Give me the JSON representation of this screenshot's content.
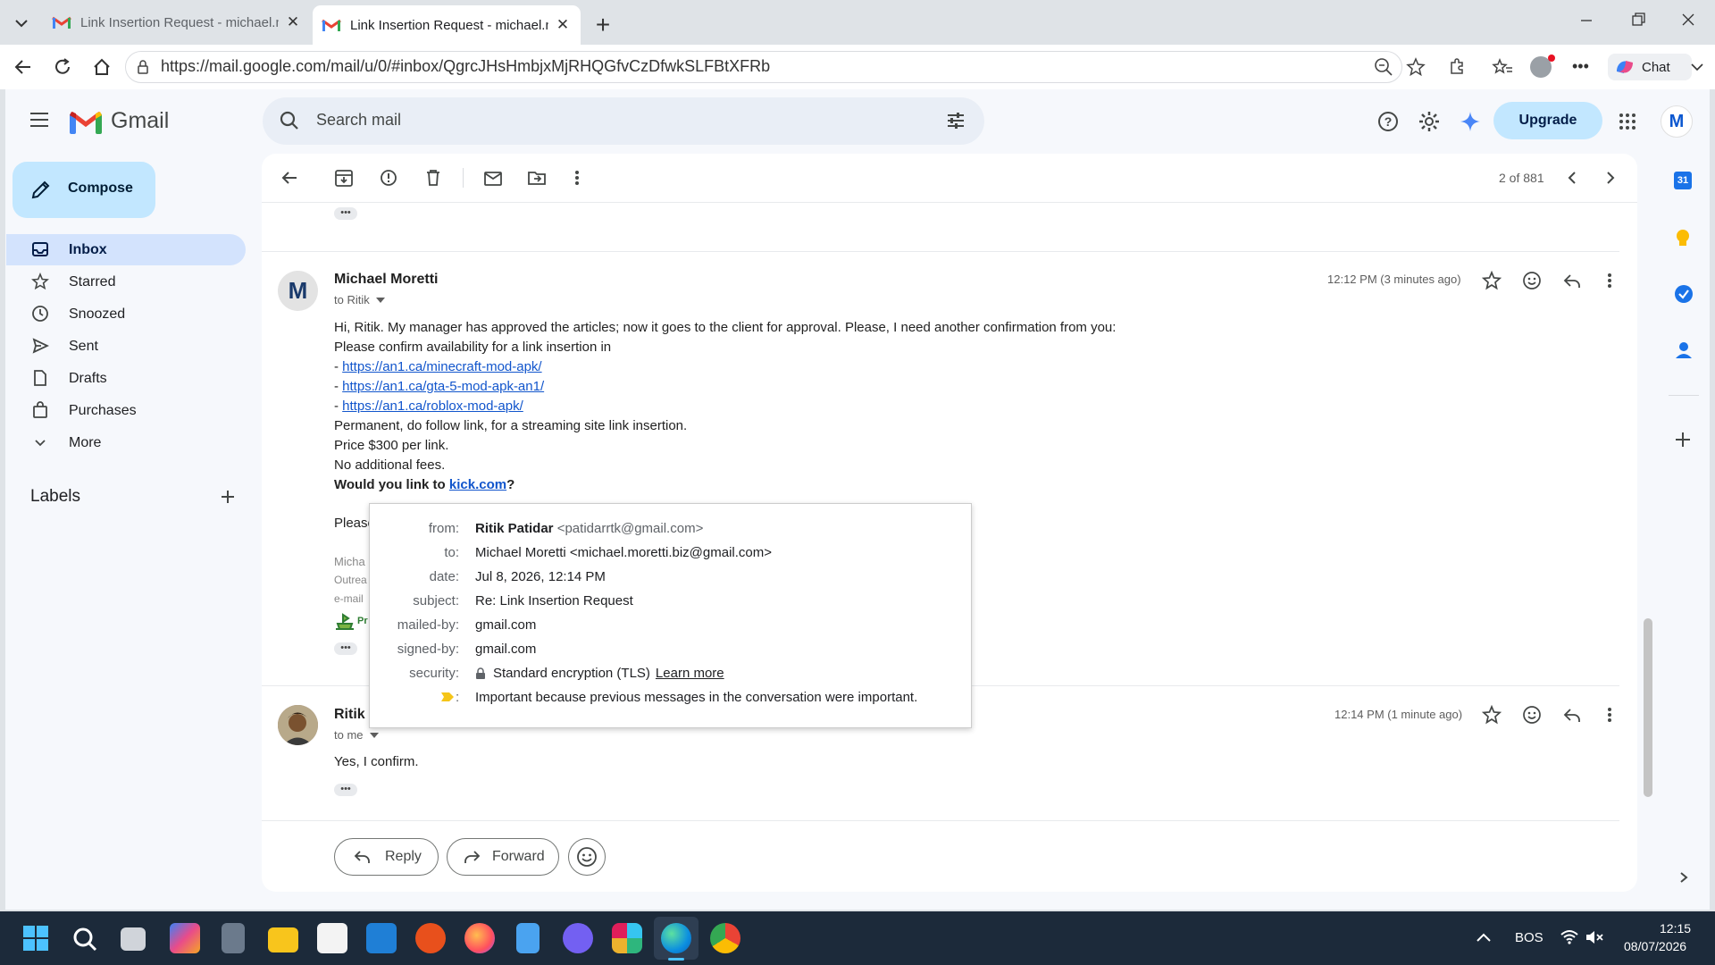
{
  "browser": {
    "tabs": [
      {
        "title": "Link Insertion Request - michael.m"
      },
      {
        "title": "Link Insertion Request - michael.m"
      }
    ],
    "url": "https://mail.google.com/mail/u/0/#inbox/QgrcJHsHmbjxMjRHQGfvCzDfwkSLFBtXFRb",
    "chat_label": "Chat"
  },
  "gmail": {
    "app_name": "Gmail",
    "search_placeholder": "Search mail",
    "upgrade_label": "Upgrade",
    "account_initial": "M",
    "compose_label": "Compose",
    "nav": [
      {
        "label": "Inbox"
      },
      {
        "label": "Starred"
      },
      {
        "label": "Snoozed"
      },
      {
        "label": "Sent"
      },
      {
        "label": "Drafts"
      },
      {
        "label": "Purchases"
      },
      {
        "label": "More"
      }
    ],
    "labels_heading": "Labels",
    "pager": "2 of 881",
    "calendar_day": "31"
  },
  "thread": {
    "msg1": {
      "sender": "Michael Moretti",
      "avatar": "M",
      "to": "to Ritik",
      "time": "12:12 PM (3 minutes ago)",
      "lines": [
        "Hi, Ritik. My manager has approved the articles; now it goes to the client for approval. Please, I need another confirmation from you:",
        "Please confirm availability for a link insertion in"
      ],
      "links": [
        "https://an1.ca/minecraft-mod-apk/",
        "https://an1.ca/gta-5-mod-apk-an1/",
        "https://an1.ca/roblox-mod-apk/"
      ],
      "link_prefix": "- ",
      "lines2": [
        "Permanent, do follow link, for a streaming site link insertion.",
        "Price  $300 per link.",
        "No additional fees."
      ],
      "question_pre": "Would you link to ",
      "question_link": "kick.com",
      "question_post": "?",
      "partial_please": "Please",
      "sig": [
        "Micha",
        "Outrea",
        "e-mail"
      ],
      "sig_logo_text": "Pr"
    },
    "msg2": {
      "sender": "Ritik",
      "to": "to me",
      "time": "12:14 PM (1 minute ago)",
      "body": "Yes, I confirm."
    },
    "reply_label": "Reply",
    "forward_label": "Forward"
  },
  "details_popup": {
    "from_label": "from:",
    "from_name": "Ritik Patidar",
    "from_email": "<patidarrtk@gmail.com>",
    "to_label": "to:",
    "to_value": "Michael Moretti <michael.moretti.biz@gmail.com>",
    "date_label": "date:",
    "date_value": "Jul 8, 2026, 12:14 PM",
    "subject_label": "subject:",
    "subject_value": "Re: Link Insertion Request",
    "mailed_label": "mailed-by:",
    "mailed_value": "gmail.com",
    "signed_label": "signed-by:",
    "signed_value": "gmail.com",
    "security_label": "security:",
    "security_value": "Standard encryption (TLS)",
    "learn_more": "Learn more",
    "important_colon": ":",
    "important_value": "Important because previous messages in the conversation were important."
  },
  "taskbar": {
    "lang": "BOS",
    "time": "12:15",
    "date": "08/07/2026"
  }
}
